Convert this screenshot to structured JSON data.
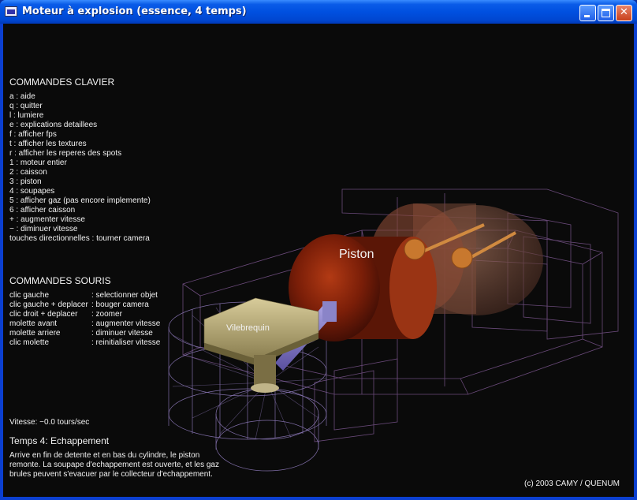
{
  "window": {
    "title": "Moteur à explosion (essence, 4 temps)",
    "controls": {
      "minimize": "minimize",
      "maximize": "maximize",
      "close": "✕"
    }
  },
  "keyboard": {
    "title": "COMMANDES CLAVIER",
    "items": [
      "a : aide",
      "q : quitter",
      " l : lumiere",
      "e : explications detaillees",
      "f : afficher fps",
      "t : afficher les textures",
      "r : afficher les reperes des spots",
      "1 : moteur entier",
      "2 : caisson",
      "3 : piston",
      "4 : soupapes",
      "5 : afficher gaz (pas encore implemente)",
      "6 : afficher caisson",
      "+ : augmenter vitesse",
      "− : diminuer vitesse",
      "touches directionnelles : tourner camera"
    ]
  },
  "mouse": {
    "title": "COMMANDES SOURIS",
    "items": [
      {
        "key": "clic gauche",
        "action": ": selectionner objet"
      },
      {
        "key": "clic gauche + deplacer",
        "action": ": bouger camera"
      },
      {
        "key": "clic droit + deplacer",
        "action": ": zoomer"
      },
      {
        "key": "molette avant",
        "action": ": augmenter vitesse"
      },
      {
        "key": "molette arriere",
        "action": ": diminuer vitesse"
      },
      {
        "key": "clic molette",
        "action": ": reinitialiser vitesse"
      }
    ]
  },
  "scene": {
    "label_piston": "Piston",
    "label_vilebrequin": "Vilebrequin"
  },
  "status": {
    "speed": "Vitesse: −0.0 tours/sec",
    "stage_title": "Temps 4: Echappement",
    "stage_lines": [
      "Arrive en fin de detente et en bas du cylindre, le piston",
      "remonte. La soupape d'echappement est ouverte, et les gaz",
      "brules peuvent s'evacuer par le collecteur d'echappement."
    ],
    "credits": "(c) 2003 CAMY / QUENUM"
  }
}
